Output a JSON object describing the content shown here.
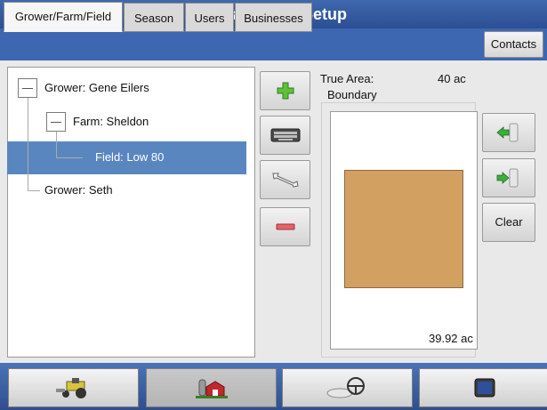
{
  "window": {
    "title": "Management Setup"
  },
  "tabs": [
    {
      "label": "Grower/Farm/Field",
      "active": true
    },
    {
      "label": "Season",
      "active": false
    },
    {
      "label": "Users",
      "active": false
    },
    {
      "label": "Businesses",
      "active": false
    }
  ],
  "contacts_label": "Contacts",
  "tree": {
    "items": [
      {
        "label": "Grower: Gene Eilers"
      },
      {
        "label": "Farm: Sheldon"
      },
      {
        "label": "Field: Low 80",
        "selected": true
      },
      {
        "label": "Grower: Seth"
      }
    ]
  },
  "details": {
    "true_area_label": "True Area:",
    "true_area_value": "40 ac",
    "boundary_label": "Boundary",
    "boundary_area": "39.92 ac",
    "clear_label": "Clear"
  },
  "colors": {
    "header": "#2c4f93",
    "selection": "#5a86bf",
    "field_fill": "#d2a061"
  },
  "icons": {
    "side": [
      "add-icon",
      "keyboard-icon",
      "wrench-icon",
      "remove-icon"
    ],
    "right": [
      "import-icon",
      "export-icon"
    ],
    "nav": [
      "tractor-icon",
      "farm-icon",
      "steering-icon",
      "display-icon"
    ]
  }
}
